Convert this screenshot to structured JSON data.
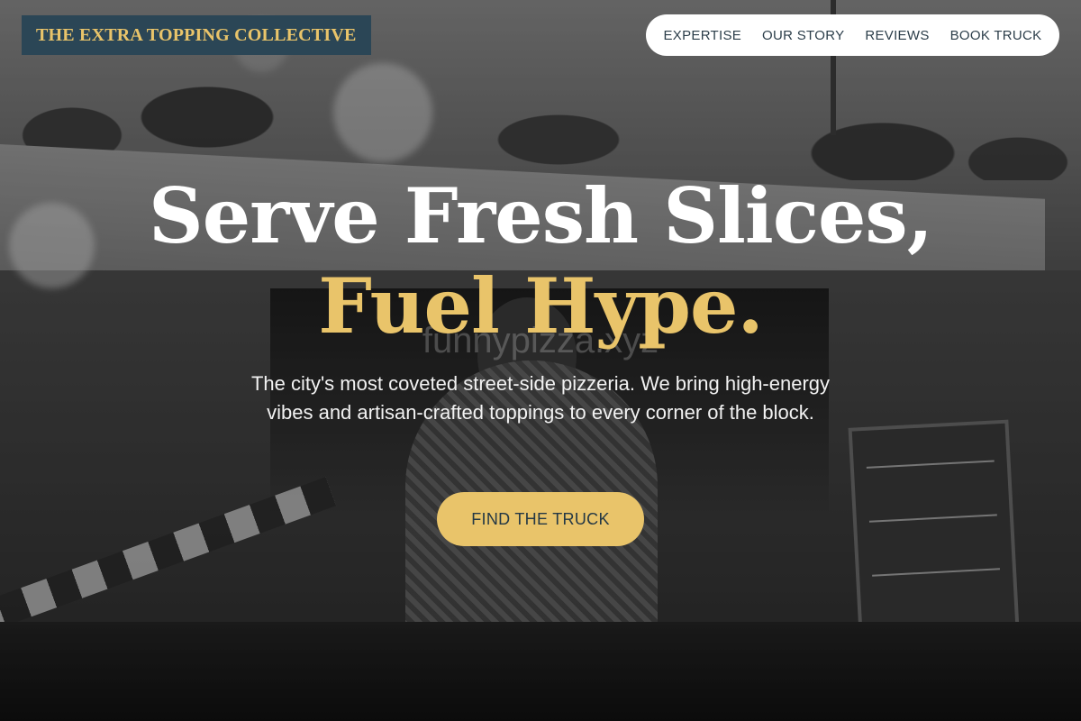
{
  "brand": {
    "name": "THE EXTRA TOPPING COLLECTIVE"
  },
  "nav": {
    "items": [
      {
        "label": "EXPERTISE"
      },
      {
        "label": "OUR STORY"
      },
      {
        "label": "REVIEWS"
      },
      {
        "label": "BOOK TRUCK"
      }
    ]
  },
  "hero": {
    "headline_line1": "Serve Fresh Slices,",
    "headline_line2": "Fuel Hype.",
    "watermark": "funnypizza.xyz",
    "subtitle": "The city's most coveted street-side pizzeria. We bring high-energy vibes and artisan-crafted toppings to every corner of the block.",
    "cta_label": "FIND THE TRUCK"
  },
  "colors": {
    "accent": "#e9c46a",
    "brand_bg": "#2b4656",
    "nav_text": "#2c3e4a"
  }
}
